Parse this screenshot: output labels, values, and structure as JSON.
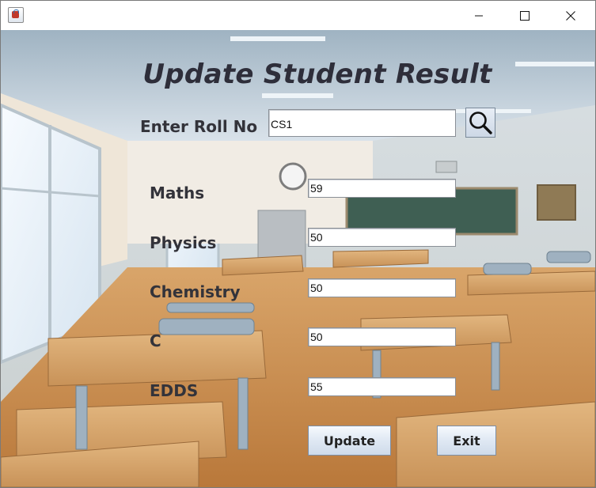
{
  "window": {
    "icon": "java-cup-icon",
    "controls": [
      "minimize-icon",
      "maximize-icon",
      "close-icon"
    ]
  },
  "heading": "Update Student Result",
  "roll": {
    "label": "Enter Roll No",
    "value": "CS1",
    "search_icon": "magnifier-icon"
  },
  "subjects": [
    {
      "label": "Maths",
      "value": "59"
    },
    {
      "label": "Physics",
      "value": "50"
    },
    {
      "label": "Chemistry",
      "value": "50"
    },
    {
      "label": "C",
      "value": "50"
    },
    {
      "label": "EDDS",
      "value": "55"
    }
  ],
  "buttons": {
    "update": "Update",
    "exit": "Exit"
  },
  "background": "classroom-illustration"
}
